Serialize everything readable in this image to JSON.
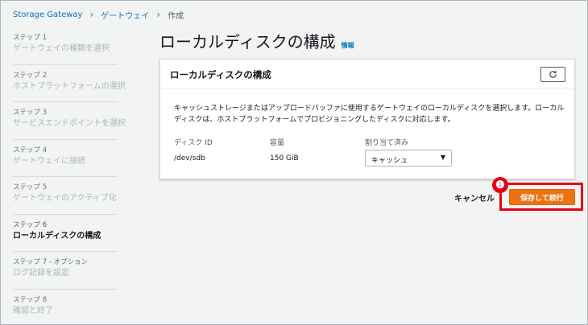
{
  "breadcrumb": {
    "items": [
      "Storage Gateway",
      "ゲートウェイ"
    ],
    "current": "作成"
  },
  "sidebar": {
    "steps": [
      {
        "num": "ステップ 1",
        "title": "ゲートウェイの種類を選択"
      },
      {
        "num": "ステップ 2",
        "title": "ホストプラットフォームの選択"
      },
      {
        "num": "ステップ 3",
        "title": "サービスエンドポイントを選択"
      },
      {
        "num": "ステップ 4",
        "title": "ゲートウェイに接続"
      },
      {
        "num": "ステップ 5",
        "title": "ゲートウェイのアクティブ化"
      },
      {
        "num": "ステップ 6",
        "title": "ローカルディスクの構成"
      },
      {
        "num": "ステップ 7 - オプション",
        "title": "ログ記録を設定"
      },
      {
        "num": "ステップ 8",
        "title": "確認と終了"
      }
    ]
  },
  "page": {
    "title": "ローカルディスクの構成",
    "info_link": "情報"
  },
  "panel": {
    "title": "ローカルディスクの構成",
    "description": "キャッシュストレージまたはアップロードバッファに使用するゲートウェイのローカルディスクを選択します。ローカルディスクは、ホストプラットフォームでプロビジョニングしたディスクに対応します。",
    "columns": {
      "disk_id": "ディスク ID",
      "capacity": "容量",
      "allocated": "割り当て済み"
    },
    "row": {
      "disk_id": "/dev/sdb",
      "capacity": "150 GiB",
      "allocated": "キャッシュ"
    }
  },
  "actions": {
    "cancel": "キャンセル",
    "save": "保存して続行"
  },
  "annotation": {
    "marker": "❶"
  },
  "colors": {
    "primary_button": "#ec7211",
    "link": "#0073bb",
    "highlight": "#e60012"
  }
}
